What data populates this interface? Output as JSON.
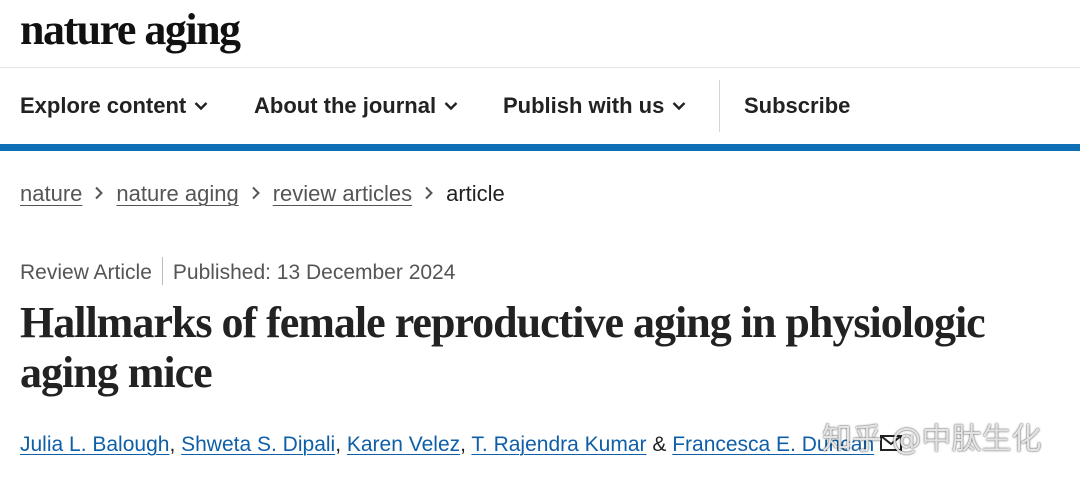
{
  "site": {
    "logo": "nature aging"
  },
  "nav": {
    "items": [
      {
        "label": "Explore content",
        "has_dropdown": true
      },
      {
        "label": "About the journal",
        "has_dropdown": true
      },
      {
        "label": "Publish with us",
        "has_dropdown": true
      },
      {
        "label": "Subscribe",
        "has_dropdown": false
      }
    ]
  },
  "breadcrumb": [
    "nature",
    "nature aging",
    "review articles",
    "article"
  ],
  "article": {
    "type": "Review Article",
    "published": "Published: 13 December 2024",
    "title": "Hallmarks of female reproductive aging in physiologic aging mice",
    "authors": [
      "Julia L. Balough",
      "Shweta S. Dipali",
      "Karen Velez",
      "T. Rajendra Kumar",
      "Francesca E. Duncan"
    ]
  },
  "watermark": "知乎 @中肽生化",
  "colors": {
    "accent_bar": "#0f6fb5",
    "link": "#0f5fa8",
    "text": "#222222"
  }
}
